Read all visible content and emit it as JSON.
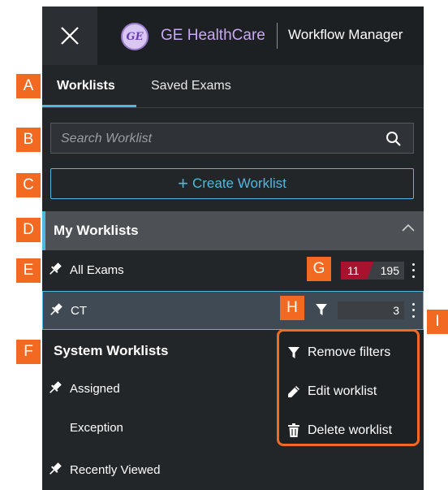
{
  "header": {
    "logo_text": "GE",
    "brand": "GE HealthCare",
    "app_title": "Workflow Manager",
    "close_icon": "close-icon"
  },
  "tabs": [
    {
      "label": "Worklists",
      "active": true
    },
    {
      "label": "Saved Exams",
      "active": false
    }
  ],
  "search": {
    "placeholder": "Search Worklist",
    "value": "",
    "icon": "search-icon"
  },
  "create_button": {
    "plus": "+",
    "label": "Create Worklist"
  },
  "my_worklists": {
    "title": "My Worklists",
    "expanded": true,
    "items": [
      {
        "label": "All Exams",
        "pinned": true,
        "badge_red": "11",
        "count": "195"
      },
      {
        "label": "CT",
        "pinned": true,
        "selected": true,
        "filtered": true,
        "count": "3"
      }
    ]
  },
  "system_worklists": {
    "title": "System Worklists",
    "items": [
      {
        "label": "Assigned",
        "pinned": true
      },
      {
        "label": "Exception",
        "pinned": false
      },
      {
        "label": "Recently Viewed",
        "pinned": true
      }
    ]
  },
  "context_menu": {
    "items": [
      {
        "label": "Remove filters",
        "icon": "filter-icon"
      },
      {
        "label": "Edit worklist",
        "icon": "pencil-icon"
      },
      {
        "label": "Delete worklist",
        "icon": "trash-icon"
      }
    ]
  },
  "annotations": [
    "A",
    "B",
    "C",
    "D",
    "E",
    "F",
    "G",
    "H",
    "I"
  ],
  "colors": {
    "accent": "#4fb8e0",
    "annotation": "#f26a21",
    "badge_red": "#a8122e",
    "brand": "#c9a7f5",
    "background": "#232629"
  }
}
